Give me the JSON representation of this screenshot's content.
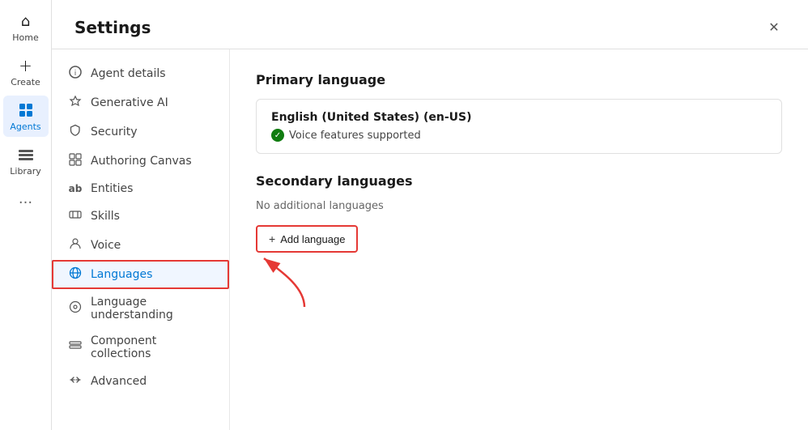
{
  "nav": {
    "items": [
      {
        "id": "home",
        "label": "Home",
        "icon": "⌂",
        "active": false
      },
      {
        "id": "create",
        "label": "Create",
        "icon": "+",
        "active": false
      },
      {
        "id": "agents",
        "label": "Agents",
        "icon": "◈",
        "active": true
      },
      {
        "id": "library",
        "label": "Library",
        "icon": "⊞",
        "active": false
      }
    ],
    "more_icon": "···"
  },
  "settings": {
    "title": "Settings",
    "close_label": "✕",
    "sidebar": {
      "items": [
        {
          "id": "agent-details",
          "label": "Agent details",
          "icon": "ℹ",
          "active": false
        },
        {
          "id": "generative-ai",
          "label": "Generative AI",
          "icon": "✦",
          "active": false
        },
        {
          "id": "security",
          "label": "Security",
          "icon": "🔒",
          "active": false
        },
        {
          "id": "authoring-canvas",
          "label": "Authoring Canvas",
          "icon": "⊞",
          "active": false
        },
        {
          "id": "entities",
          "label": "Entities",
          "icon": "ab",
          "active": false
        },
        {
          "id": "skills",
          "label": "Skills",
          "icon": "⊟",
          "active": false
        },
        {
          "id": "voice",
          "label": "Voice",
          "icon": "👤",
          "active": false
        },
        {
          "id": "languages",
          "label": "Languages",
          "icon": "✦",
          "active": true,
          "highlighted": true
        },
        {
          "id": "language-understanding",
          "label": "Language understanding",
          "icon": "⊙",
          "active": false
        },
        {
          "id": "component-collections",
          "label": "Component collections",
          "icon": "⊟",
          "active": false
        },
        {
          "id": "advanced",
          "label": "Advanced",
          "icon": "⇄",
          "active": false
        }
      ]
    },
    "content": {
      "primary_language_section": "Primary language",
      "primary_language_name": "English (United States) (en-US)",
      "voice_supported_label": "Voice features supported",
      "secondary_languages_section": "Secondary languages",
      "no_languages_label": "No additional languages",
      "add_language_label": "Add language"
    }
  }
}
